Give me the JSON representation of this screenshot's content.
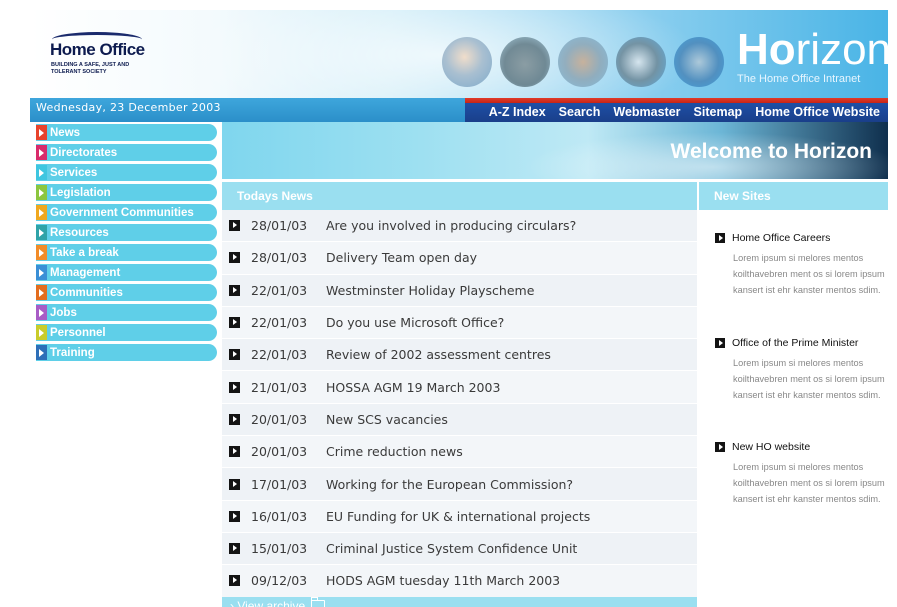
{
  "header": {
    "logo_title": "Home Office",
    "logo_tagline": "BUILDING A SAFE, JUST AND TOLERANT SOCIETY",
    "brand_ho": "Ho",
    "brand_rest": "rizon",
    "brand_subtitle": "The Home Office Intranet"
  },
  "navbar": {
    "date": "Wednesday, 23 December 2003",
    "links": [
      "A-Z Index",
      "Search",
      "Webmaster",
      "Sitemap",
      "Home Office Website"
    ]
  },
  "sidebar": {
    "items": [
      {
        "label": "News",
        "color": "#e8432c"
      },
      {
        "label": "Directorates",
        "color": "#d92b6b"
      },
      {
        "label": "Services",
        "color": "#3ec6e0"
      },
      {
        "label": "Legislation",
        "color": "#8cc63e"
      },
      {
        "label": "Government Communities",
        "color": "#f0a81f"
      },
      {
        "label": "Resources",
        "color": "#2fa3a8"
      },
      {
        "label": "Take a break",
        "color": "#f28c28"
      },
      {
        "label": "Management",
        "color": "#3a8fd6"
      },
      {
        "label": "Communities",
        "color": "#e36d1e"
      },
      {
        "label": "Jobs",
        "color": "#a85cc6"
      },
      {
        "label": "Personnel",
        "color": "#c9cc2a"
      },
      {
        "label": "Training",
        "color": "#2e6fb8"
      }
    ]
  },
  "banner": {
    "title": "Welcome to Horizon"
  },
  "news": {
    "heading": "Todays News",
    "items": [
      {
        "date": "28/01/03",
        "title": "Are you involved in producing circulars?"
      },
      {
        "date": "28/01/03",
        "title": "Delivery Team open day"
      },
      {
        "date": "22/01/03",
        "title": "Westminster Holiday Playscheme"
      },
      {
        "date": "22/01/03",
        "title": "Do you use Microsoft Office?"
      },
      {
        "date": "22/01/03",
        "title": "Review of 2002 assessment centres"
      },
      {
        "date": "21/01/03",
        "title": "HOSSA AGM 19 March 2003"
      },
      {
        "date": "20/01/03",
        "title": "New SCS vacancies"
      },
      {
        "date": "20/01/03",
        "title": "Crime reduction news"
      },
      {
        "date": "17/01/03",
        "title": "Working for the European Commission?"
      },
      {
        "date": "16/01/03",
        "title": "EU Funding for UK & international projects"
      },
      {
        "date": "15/01/03",
        "title": "Criminal Justice System Confidence Unit"
      },
      {
        "date": "09/12/03",
        "title": "HODS AGM tuesday 11th March 2003"
      }
    ],
    "archive_label": "› View archive"
  },
  "new_sites": {
    "heading": "New Sites",
    "items": [
      {
        "title": "Home Office Careers",
        "desc": "Lorem ipsum si melores mentos koilthavebren ment os si lorem ipsum kansert ist ehr kanster mentos sdim."
      },
      {
        "title": "Office of the Prime Minister",
        "desc": "Lorem ipsum si melores mentos koilthavebren ment os si lorem ipsum kansert ist ehr kanster mentos sdim."
      },
      {
        "title": "New HO website",
        "desc": "Lorem ipsum si melores mentos koilthavebren ment os si lorem ipsum kansert ist ehr kanster mentos sdim."
      }
    ]
  },
  "colors": {
    "accent_blue": "#3ea6dc",
    "panel_cyan": "#9adff0",
    "nav_dark_blue": "#1a3f8a",
    "nav_red": "#e03a2a"
  }
}
